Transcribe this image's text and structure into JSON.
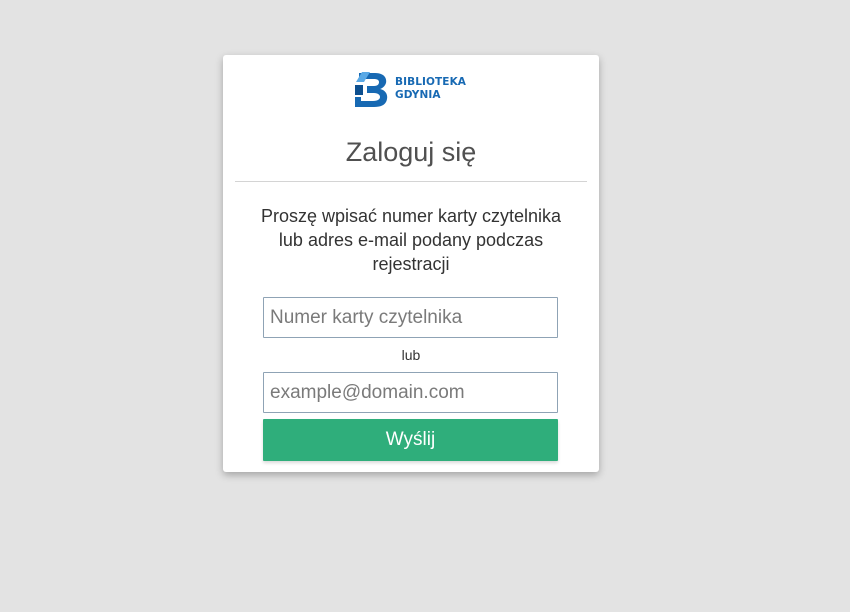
{
  "logo": {
    "line1": "BIBLIOTEKA",
    "line2": "GDYNIA",
    "color": "#1769b3"
  },
  "login": {
    "title": "Zaloguj się",
    "instructions": "Proszę wpisać numer karty czytelnika lub adres e-mail podany podczas rejestracji",
    "card_field": {
      "placeholder": "Numer karty czytelnika",
      "value": ""
    },
    "or_label": "lub",
    "email_field": {
      "placeholder": "example@domain.com",
      "value": ""
    },
    "submit_label": "Wyślij"
  },
  "colors": {
    "background": "#e3e3e3",
    "card": "#ffffff",
    "button": "#2fae7b"
  }
}
